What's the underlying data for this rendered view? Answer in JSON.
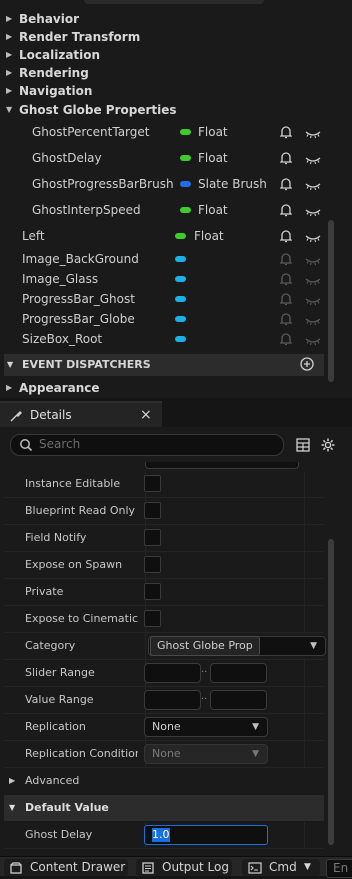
{
  "variables_panel": {
    "categories_top": [
      {
        "label": "Behavior",
        "expanded": false
      },
      {
        "label": "Render Transform",
        "expanded": false
      },
      {
        "label": "Localization",
        "expanded": false
      },
      {
        "label": "Rendering",
        "expanded": false
      },
      {
        "label": "Navigation",
        "expanded": false
      }
    ],
    "ghost_category": {
      "label": "Ghost Globe Properties",
      "expanded": true
    },
    "ghost_vars": [
      {
        "name": "GhostPercentTarget",
        "type": "Float",
        "pill_color": "#3fcc2a"
      },
      {
        "name": "GhostDelay",
        "type": "Float",
        "pill_color": "#3fcc2a"
      },
      {
        "name": "GhostProgressBarBrush",
        "type": "Slate Brush",
        "pill_color": "#1f6fe8"
      },
      {
        "name": "GhostInterpSpeed",
        "type": "Float",
        "pill_color": "#3fcc2a"
      }
    ],
    "other_vars": [
      {
        "name": "Left",
        "type": "Float",
        "pill_color": "#3fcc2a"
      },
      {
        "name": "Image_BackGround",
        "type": "",
        "pill_color": "#1ab0e8"
      },
      {
        "name": "Image_Glass",
        "type": "",
        "pill_color": "#1ab0e8"
      },
      {
        "name": "ProgressBar_Ghost",
        "type": "",
        "pill_color": "#1ab0e8"
      },
      {
        "name": "ProgressBar_Globe",
        "type": "",
        "pill_color": "#1ab0e8"
      },
      {
        "name": "SizeBox_Root",
        "type": "",
        "pill_color": "#1ab0e8"
      }
    ],
    "event_dispatchers_label": "EVENT DISPATCHERS",
    "appearance_label": "Appearance"
  },
  "details": {
    "tab_title": "Details",
    "close_glyph": "×",
    "search_placeholder": "Search",
    "properties": [
      {
        "label": "Instance Editable",
        "kind": "checkbox",
        "checked": false
      },
      {
        "label": "Blueprint Read Only",
        "kind": "checkbox",
        "checked": false
      },
      {
        "label": "Field Notify",
        "kind": "checkbox",
        "checked": false
      },
      {
        "label": "Expose on Spawn",
        "kind": "checkbox",
        "checked": false
      },
      {
        "label": "Private",
        "kind": "checkbox",
        "checked": false
      },
      {
        "label": "Expose to Cinematics",
        "kind": "checkbox",
        "checked": false
      }
    ],
    "category_label": "Category",
    "category_value": "Ghost Globe Prop",
    "slider_range_label": "Slider Range",
    "value_range_label": "Value Range",
    "range_separator": "..",
    "replication_label": "Replication",
    "replication_value": "None",
    "replication_condition_label": "Replication Condition",
    "replication_condition_value": "None",
    "advanced_label": "Advanced",
    "default_value_label": "Default Value",
    "ghost_delay_label": "Ghost Delay",
    "ghost_delay_value": "1.0"
  },
  "bottom_bar": {
    "content_drawer": "Content Drawer",
    "output_log": "Output Log",
    "cmd": "Cmd",
    "console_placeholder": "En"
  },
  "colors": {
    "float_pin": "#3fcc2a",
    "struct_pin": "#1f6fe8",
    "object_pin": "#1ab0e8",
    "selection": "#1a6fe0"
  }
}
